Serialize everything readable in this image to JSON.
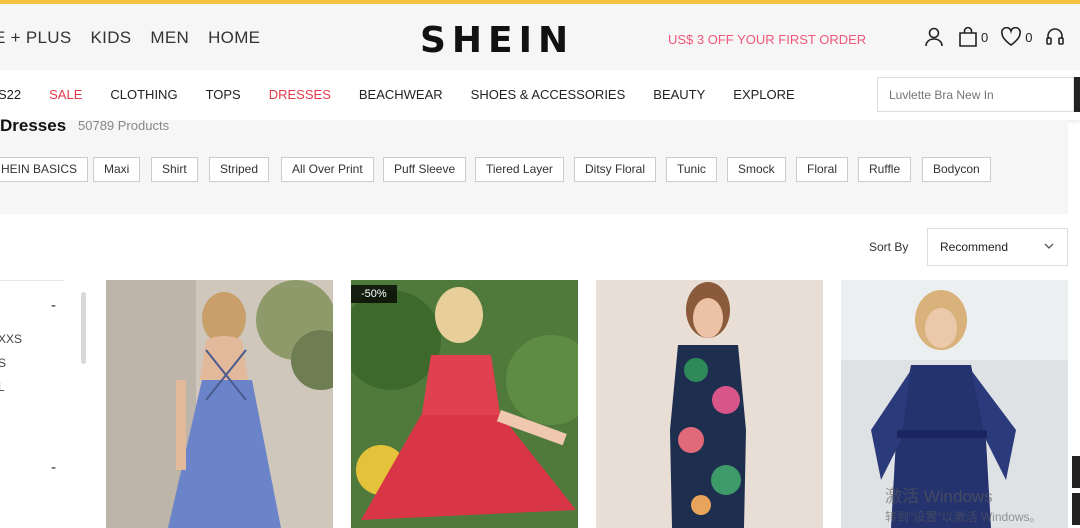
{
  "brand": {
    "logo": "SHEIN",
    "promo": "US$ 3 OFF YOUR FIRST ORDER",
    "cart_count": "0",
    "wishlist_count": "0"
  },
  "top_nav": [
    "E + PLUS",
    "KIDS",
    "MEN",
    "HOME"
  ],
  "category_nav": [
    {
      "label": "S22",
      "highlight": false
    },
    {
      "label": "SALE",
      "highlight": true
    },
    {
      "label": "CLOTHING",
      "highlight": false
    },
    {
      "label": "TOPS",
      "highlight": false
    },
    {
      "label": "DRESSES",
      "highlight": true
    },
    {
      "label": "BEACHWEAR",
      "highlight": false
    },
    {
      "label": "SHOES & ACCESSORIES",
      "highlight": false
    },
    {
      "label": "BEAUTY",
      "highlight": false
    },
    {
      "label": "EXPLORE",
      "highlight": false
    }
  ],
  "search": {
    "placeholder": "Luvlette Bra New In"
  },
  "listing": {
    "title": "Dresses",
    "product_count": "50789 Products"
  },
  "tags": [
    "HEIN BASICS",
    "Maxi",
    "Shirt",
    "Striped",
    "All Over Print",
    "Puff Sleeve",
    "Tiered Layer",
    "Ditsy Floral",
    "Tunic",
    "Smock",
    "Floral",
    "Ruffle",
    "Bodycon"
  ],
  "sort": {
    "label": "Sort By",
    "value": "Recommend"
  },
  "sidebar": {
    "collapse_symbol": "-",
    "size_options": [
      "XXS",
      "S",
      "L"
    ]
  },
  "products": [
    {
      "badge": ""
    },
    {
      "badge": "-50%"
    },
    {
      "badge": ""
    },
    {
      "badge": ""
    }
  ],
  "watermark": {
    "line1": "激活 Windows",
    "line2": "转到\"设置\"以激活 Windows。"
  },
  "colors": {
    "accent_top": "#f5c242",
    "sale_red": "#e4394a",
    "promo_pink": "#f0587b"
  }
}
